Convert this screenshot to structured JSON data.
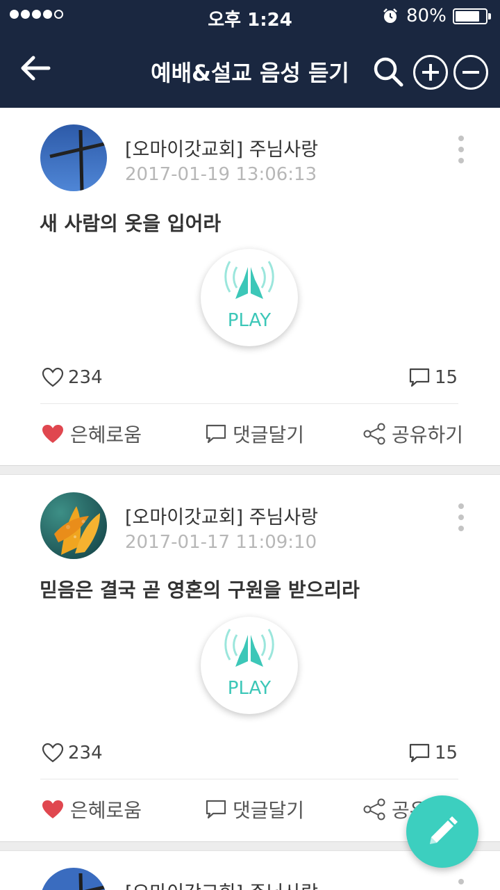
{
  "status_bar": {
    "time": "오후 1:24",
    "battery": "80%"
  },
  "header": {
    "title": "예배&설교 음성 듣기"
  },
  "colors": {
    "header_bg": "#1a2740",
    "accent": "#3ccfbf",
    "heart": "#e0474f"
  },
  "posts": [
    {
      "author": "[오마이갓교회] 주님사랑",
      "date": "2017-01-19 13:06:13",
      "title": "새 사람의 옷을 입어라",
      "play_label": "PLAY",
      "likes": "234",
      "comments": "15",
      "actions": {
        "grace": "은혜로움",
        "comment": "댓글달기",
        "share": "공유하기"
      }
    },
    {
      "author": "[오마이갓교회] 주님사랑",
      "date": "2017-01-17 11:09:10",
      "title": "믿음은 결국 곧 영혼의 구원을 받으리라",
      "play_label": "PLAY",
      "likes": "234",
      "comments": "15",
      "actions": {
        "grace": "은혜로움",
        "comment": "댓글달기",
        "share": "공유하기"
      }
    },
    {
      "author": "[오마이갓교회] 주님사랑"
    }
  ]
}
